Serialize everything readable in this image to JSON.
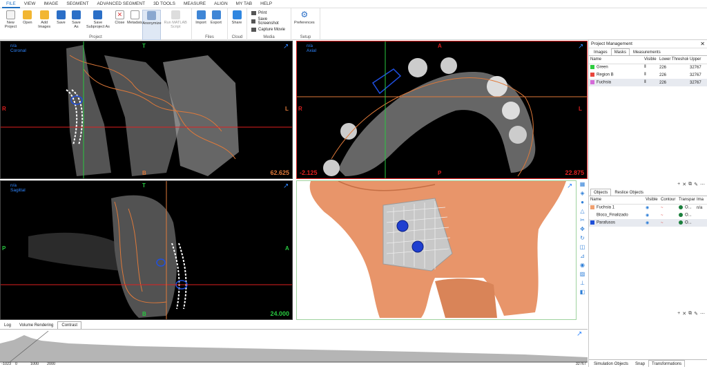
{
  "menu": [
    "FILE",
    "VIEW",
    "IMAGE",
    "SEGMENT",
    "ADVANCED SEGMENT",
    "3D TOOLS",
    "MEASURE",
    "ALIGN",
    "MY TAB",
    "HELP"
  ],
  "ribbon": {
    "project": {
      "label": "Project",
      "buttons": [
        "New Project",
        "Open",
        "Add Images",
        "Save",
        "Save As",
        "Save Subproject As",
        "Close",
        "Metadata",
        "Anonymize",
        "Run MATLAB Script"
      ]
    },
    "files": {
      "label": "Files",
      "buttons": [
        "Import",
        "Export"
      ]
    },
    "cloud": {
      "label": "Cloud",
      "buttons": [
        "Share"
      ]
    },
    "media": {
      "label": "Media",
      "items": [
        "Print",
        "Save Screenshot",
        "Capture Movie"
      ]
    },
    "setup": {
      "label": "Setup",
      "buttons": [
        "Preferences"
      ]
    }
  },
  "viewports": {
    "coronal": {
      "na": "n/a",
      "view": "Coronal",
      "top": "T",
      "left": "R",
      "right": "L",
      "bottom": "B",
      "value": "62.625"
    },
    "axial": {
      "na": "n/a",
      "view": "Axial",
      "top": "A",
      "left": "R",
      "right": "L",
      "bottom": "P",
      "value_left": "-2.125",
      "value": "22.875"
    },
    "sagittal": {
      "na": "n/a",
      "view": "Sagittal",
      "top": "T",
      "left": "P",
      "right": "A",
      "bottom": "B",
      "value": "24.000"
    }
  },
  "histogram": {
    "tabs": [
      "Log",
      "Volume Rendering",
      "Contrast"
    ],
    "active_tab": "Contrast",
    "ticks": [
      "-1023",
      "0",
      "1000",
      "2000",
      "32767"
    ]
  },
  "project_panel": {
    "title": "Project Management",
    "tabs": [
      "Images",
      "Masks",
      "Measurements"
    ],
    "active_tab": "Masks",
    "columns": [
      "Name",
      "Visible",
      "Lower Threshold",
      "Upper"
    ],
    "masks": [
      {
        "name": "Green",
        "color": "#2ecc40",
        "lower": "226",
        "upper": "32767"
      },
      {
        "name": "Region B",
        "color": "#e8453c",
        "lower": "226",
        "upper": "32767"
      },
      {
        "name": "Fuchsia",
        "color": "#d46ad8",
        "lower": "226",
        "upper": "32767"
      }
    ]
  },
  "objects_panel": {
    "tabs": [
      "Objects",
      "Reslice Objects"
    ],
    "active_tab": "Objects",
    "columns": [
      "Name",
      "Visible",
      "Contour",
      "Transpar",
      "Ima"
    ],
    "objects": [
      {
        "name": "Fuchsia 1",
        "color": "#f0a070",
        "trans": "O...",
        "extra": "n/a"
      },
      {
        "name": "Bloco_Finalizado",
        "color": "",
        "trans": "O...",
        "extra": ""
      },
      {
        "name": "Parafusos",
        "color": "#1e4fd8",
        "trans": "O...",
        "extra": ""
      }
    ]
  },
  "bottom_tabs": [
    "Simulation Objects",
    "Snap",
    "Transformations"
  ],
  "active_bottom_tab": "Transformations"
}
